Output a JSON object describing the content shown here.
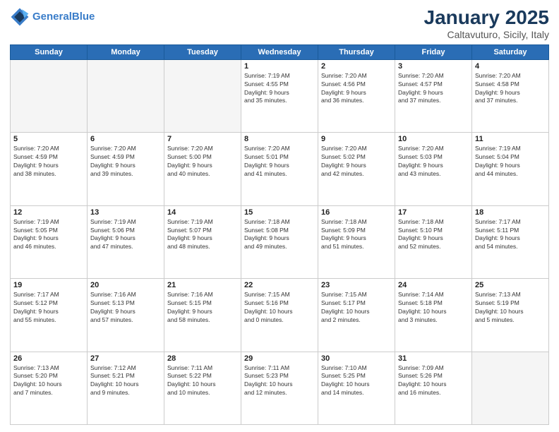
{
  "header": {
    "logo_line1": "General",
    "logo_line2": "Blue",
    "month_year": "January 2025",
    "location": "Caltavuturo, Sicily, Italy"
  },
  "days_of_week": [
    "Sunday",
    "Monday",
    "Tuesday",
    "Wednesday",
    "Thursday",
    "Friday",
    "Saturday"
  ],
  "weeks": [
    [
      {
        "day": "",
        "info": ""
      },
      {
        "day": "",
        "info": ""
      },
      {
        "day": "",
        "info": ""
      },
      {
        "day": "1",
        "info": "Sunrise: 7:19 AM\nSunset: 4:55 PM\nDaylight: 9 hours\nand 35 minutes."
      },
      {
        "day": "2",
        "info": "Sunrise: 7:20 AM\nSunset: 4:56 PM\nDaylight: 9 hours\nand 36 minutes."
      },
      {
        "day": "3",
        "info": "Sunrise: 7:20 AM\nSunset: 4:57 PM\nDaylight: 9 hours\nand 37 minutes."
      },
      {
        "day": "4",
        "info": "Sunrise: 7:20 AM\nSunset: 4:58 PM\nDaylight: 9 hours\nand 37 minutes."
      }
    ],
    [
      {
        "day": "5",
        "info": "Sunrise: 7:20 AM\nSunset: 4:59 PM\nDaylight: 9 hours\nand 38 minutes."
      },
      {
        "day": "6",
        "info": "Sunrise: 7:20 AM\nSunset: 4:59 PM\nDaylight: 9 hours\nand 39 minutes."
      },
      {
        "day": "7",
        "info": "Sunrise: 7:20 AM\nSunset: 5:00 PM\nDaylight: 9 hours\nand 40 minutes."
      },
      {
        "day": "8",
        "info": "Sunrise: 7:20 AM\nSunset: 5:01 PM\nDaylight: 9 hours\nand 41 minutes."
      },
      {
        "day": "9",
        "info": "Sunrise: 7:20 AM\nSunset: 5:02 PM\nDaylight: 9 hours\nand 42 minutes."
      },
      {
        "day": "10",
        "info": "Sunrise: 7:20 AM\nSunset: 5:03 PM\nDaylight: 9 hours\nand 43 minutes."
      },
      {
        "day": "11",
        "info": "Sunrise: 7:19 AM\nSunset: 5:04 PM\nDaylight: 9 hours\nand 44 minutes."
      }
    ],
    [
      {
        "day": "12",
        "info": "Sunrise: 7:19 AM\nSunset: 5:05 PM\nDaylight: 9 hours\nand 46 minutes."
      },
      {
        "day": "13",
        "info": "Sunrise: 7:19 AM\nSunset: 5:06 PM\nDaylight: 9 hours\nand 47 minutes."
      },
      {
        "day": "14",
        "info": "Sunrise: 7:19 AM\nSunset: 5:07 PM\nDaylight: 9 hours\nand 48 minutes."
      },
      {
        "day": "15",
        "info": "Sunrise: 7:18 AM\nSunset: 5:08 PM\nDaylight: 9 hours\nand 49 minutes."
      },
      {
        "day": "16",
        "info": "Sunrise: 7:18 AM\nSunset: 5:09 PM\nDaylight: 9 hours\nand 51 minutes."
      },
      {
        "day": "17",
        "info": "Sunrise: 7:18 AM\nSunset: 5:10 PM\nDaylight: 9 hours\nand 52 minutes."
      },
      {
        "day": "18",
        "info": "Sunrise: 7:17 AM\nSunset: 5:11 PM\nDaylight: 9 hours\nand 54 minutes."
      }
    ],
    [
      {
        "day": "19",
        "info": "Sunrise: 7:17 AM\nSunset: 5:12 PM\nDaylight: 9 hours\nand 55 minutes."
      },
      {
        "day": "20",
        "info": "Sunrise: 7:16 AM\nSunset: 5:13 PM\nDaylight: 9 hours\nand 57 minutes."
      },
      {
        "day": "21",
        "info": "Sunrise: 7:16 AM\nSunset: 5:15 PM\nDaylight: 9 hours\nand 58 minutes."
      },
      {
        "day": "22",
        "info": "Sunrise: 7:15 AM\nSunset: 5:16 PM\nDaylight: 10 hours\nand 0 minutes."
      },
      {
        "day": "23",
        "info": "Sunrise: 7:15 AM\nSunset: 5:17 PM\nDaylight: 10 hours\nand 2 minutes."
      },
      {
        "day": "24",
        "info": "Sunrise: 7:14 AM\nSunset: 5:18 PM\nDaylight: 10 hours\nand 3 minutes."
      },
      {
        "day": "25",
        "info": "Sunrise: 7:13 AM\nSunset: 5:19 PM\nDaylight: 10 hours\nand 5 minutes."
      }
    ],
    [
      {
        "day": "26",
        "info": "Sunrise: 7:13 AM\nSunset: 5:20 PM\nDaylight: 10 hours\nand 7 minutes."
      },
      {
        "day": "27",
        "info": "Sunrise: 7:12 AM\nSunset: 5:21 PM\nDaylight: 10 hours\nand 9 minutes."
      },
      {
        "day": "28",
        "info": "Sunrise: 7:11 AM\nSunset: 5:22 PM\nDaylight: 10 hours\nand 10 minutes."
      },
      {
        "day": "29",
        "info": "Sunrise: 7:11 AM\nSunset: 5:23 PM\nDaylight: 10 hours\nand 12 minutes."
      },
      {
        "day": "30",
        "info": "Sunrise: 7:10 AM\nSunset: 5:25 PM\nDaylight: 10 hours\nand 14 minutes."
      },
      {
        "day": "31",
        "info": "Sunrise: 7:09 AM\nSunset: 5:26 PM\nDaylight: 10 hours\nand 16 minutes."
      },
      {
        "day": "",
        "info": ""
      }
    ]
  ]
}
